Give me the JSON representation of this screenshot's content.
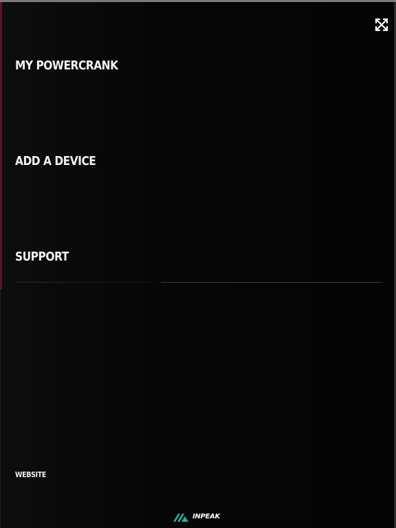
{
  "menu": {
    "items": [
      {
        "label": "MY POWERCRANK"
      },
      {
        "label": "ADD A DEVICE"
      },
      {
        "label": "SUPPORT"
      }
    ],
    "website_label": "WEBSITE"
  },
  "brand": {
    "name": "INPEAK",
    "mark_color": "#1fb3a6"
  },
  "icons": {
    "close": "close-icon",
    "brand_mark": "inpeak-logo-mark-icon"
  },
  "colors": {
    "background": "#050505",
    "text": "#f2f2f2",
    "accent_left_edge": "#5a1626"
  }
}
